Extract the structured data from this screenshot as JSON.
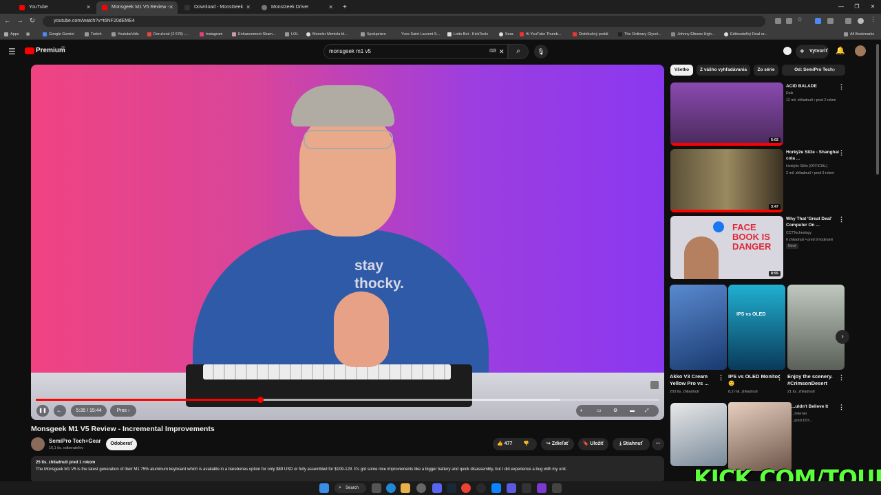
{
  "browser": {
    "tabs": [
      {
        "label": "YouTube",
        "color": "#ff0000"
      },
      {
        "label": "Monsgeek M1 V5 Review -",
        "color": "#ff0000"
      },
      {
        "label": "Download - MonsGeek",
        "color": "#222222"
      },
      {
        "label": "MonsGeek Driver",
        "color": "#555555"
      }
    ],
    "url": "youtube.com/watch?v=t6NF20dEME4",
    "bookmarks": [
      "Apps",
      "Google Gemini",
      "Twitch",
      "YoutubeVids",
      "Doručené (2 678) -...",
      "Instagram",
      "Enhancement Sham...",
      "LOL",
      "Moncler Montcla bl...",
      "Spolupráce",
      "Yves Saint Laurent S...",
      "Lotto Bot - KickTools",
      "Sora",
      "AI YouTube Thumb...",
      "Distribučný portál",
      "The Ordinary Glycol...",
      "Johnny Elbows High...",
      "Editovateľný Deal or...",
      "All Bookmarks"
    ]
  },
  "masthead": {
    "logo": "Premium",
    "logo_superscript": "SK",
    "search_value": "monsgeek m1 v5",
    "create_label": "Vytvoriť"
  },
  "player": {
    "time": "5:35 / 15:44",
    "chapter": "Pros",
    "shirt_text": "stay\nthocky.",
    "progress_played": 0.36,
    "progress_loaded": 0.84
  },
  "video": {
    "title": "Monsgeek M1 V5 Review - Incremental Improvements",
    "channel": "SemiPro Tech+Gear",
    "subscribers": "16,1 tis. odberateľov",
    "subscribe_label": "Odoberať",
    "likes": "477",
    "share_label": "Zdieľať",
    "save_label": "Uložiť",
    "download_label": "Stiahnuť",
    "stats": "25 tis. zhliadnutí  pred 1 rokom",
    "description": "The Monsgeek M1 V5 is the latest generation of their M1 75% aluminum keyboard which is available in a barebones option for only $89 USD or fully assembled for $109-129. It's got some nice improvements like a bigger battery and quick disassembly, but I did experience a bug with my unit."
  },
  "chips": [
    "Všetko",
    "Z vášho vyhľadávania",
    "Zo série",
    "Od: SemiPro Tech"
  ],
  "recommendations": [
    {
      "title": "ACID BALADE",
      "channel": "Ralk",
      "meta": "12 mil. zhliadnutí • pred 2 rokmi",
      "duration": "5:02",
      "thumb": "#7a4a9a"
    },
    {
      "title": "Horkýže Slíže - Shanghai cola ...",
      "channel": "Horkýže Slíže (OFFICIAL)",
      "meta": "2 mil. zhliadnutí • pred 9 rokmi",
      "duration": "3:47",
      "thumb": "#6b6040"
    },
    {
      "title": "Why That 'Great Deal' Computer On ...",
      "channel": "CCTTechnology",
      "meta": "6 zhliadnutí • pred 9 hodinami",
      "badge": "Nové",
      "duration": "8:55",
      "thumb_text": "FACE BOOK IS DANGER",
      "thumb": "#d0cfd6"
    }
  ],
  "shorts": [
    {
      "title": "Akko V3 Cream Yellow Pro vs ...",
      "meta": "203 tis. zhliadnutí",
      "thumb": "#3c6eb0"
    },
    {
      "title": "IPS vs OLED Monitor 😊",
      "meta": "8,2 mil. zhliadnutí",
      "thumb_text": "IPS vs OLED",
      "thumb": "#1aa0c0"
    },
    {
      "title": "Enjoy the scenery. #CrimsonDesert",
      "meta": "21 tis. zhliadnutí",
      "thumb": "#8a9088"
    }
  ],
  "partial_rec": {
    "title": "...uldn't Believe It",
    "channel": "...Internet",
    "meta": "...pred 18 h..."
  },
  "overlay": {
    "kick_text": "KICK.COM/TOUKEN"
  },
  "taskbar": {
    "search_label": "Search"
  }
}
